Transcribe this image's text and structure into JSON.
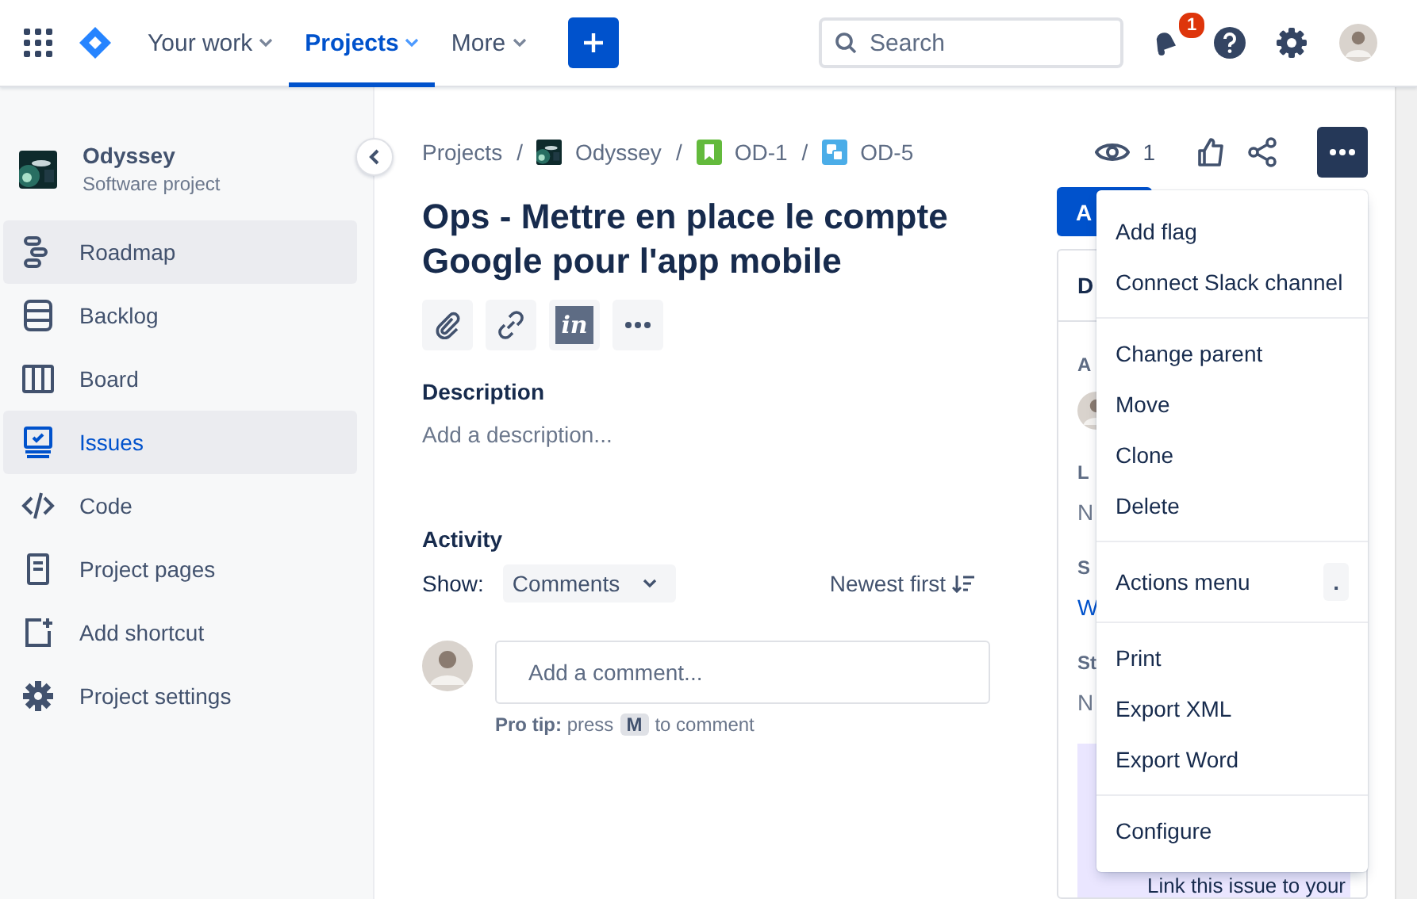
{
  "nav": {
    "items": [
      {
        "label": "Your work",
        "selected": false
      },
      {
        "label": "Projects",
        "selected": true
      },
      {
        "label": "More",
        "selected": false
      }
    ],
    "search": {
      "placeholder": "Search"
    },
    "notification_count": "1"
  },
  "sidebar": {
    "project": {
      "name": "Odyssey",
      "type": "Software project"
    },
    "items": [
      {
        "label": "Roadmap",
        "kind": "roadmap",
        "selected": false,
        "hovered": true
      },
      {
        "label": "Backlog",
        "kind": "backlog",
        "selected": false,
        "hovered": false
      },
      {
        "label": "Board",
        "kind": "board",
        "selected": false,
        "hovered": false
      },
      {
        "label": "Issues",
        "kind": "issues",
        "selected": true,
        "hovered": false
      },
      {
        "label": "Code",
        "kind": "code",
        "selected": false,
        "hovered": false
      },
      {
        "label": "Project pages",
        "kind": "pages",
        "selected": false,
        "hovered": false
      },
      {
        "label": "Add shortcut",
        "kind": "shortcut",
        "selected": false,
        "hovered": false
      },
      {
        "label": "Project settings",
        "kind": "settings",
        "selected": false,
        "hovered": false
      }
    ]
  },
  "breadcrumb_separator": "/",
  "breadcrumbs": [
    {
      "label": "Projects",
      "kind": "text"
    },
    {
      "label": "Odyssey",
      "kind": "project"
    },
    {
      "label": "OD-1",
      "kind": "epic"
    },
    {
      "label": "OD-5",
      "kind": "subtask"
    }
  ],
  "watchers": "1",
  "issue": {
    "title": "Ops - Mettre en place le compte Google pour l'app mobile",
    "action_buttons": [
      {
        "kind": "attachment"
      },
      {
        "kind": "link"
      },
      {
        "kind": "app",
        "label": "in"
      },
      {
        "kind": "more"
      }
    ],
    "description_heading": "Description",
    "description_placeholder": "Add a description..."
  },
  "activity": {
    "heading": "Activity",
    "show_label": "Show:",
    "filter": "Comments",
    "sort": "Newest first",
    "comment_placeholder": "Add a comment...",
    "tip": "**Pro tip:** press",
    "tip_key": "M",
    "tip_end": "to comment"
  },
  "side_panel": {
    "button": "A",
    "card_heading": "D",
    "fields": [
      {
        "label": "A",
        "kind": "avatar"
      },
      {
        "label": "L",
        "kind": "text",
        "value": "N"
      },
      {
        "label": "S",
        "kind": "link",
        "value": "W"
      },
      {
        "label": "St",
        "kind": "text",
        "value": "N"
      }
    ],
    "promo": "Link this issue to your"
  },
  "menu": {
    "groups": [
      {
        "items": [
          {
            "label": "Add flag"
          },
          {
            "label": "Connect Slack channel"
          }
        ]
      },
      {
        "items": [
          {
            "label": "Change parent"
          },
          {
            "label": "Move"
          },
          {
            "label": "Clone"
          },
          {
            "label": "Delete"
          }
        ]
      },
      {
        "items": [
          {
            "label": "Actions menu",
            "shortcut": "."
          }
        ]
      },
      {
        "items": [
          {
            "label": "Print"
          },
          {
            "label": "Export XML"
          },
          {
            "label": "Export Word"
          }
        ]
      },
      {
        "items": [
          {
            "label": "Configure"
          }
        ]
      }
    ]
  }
}
